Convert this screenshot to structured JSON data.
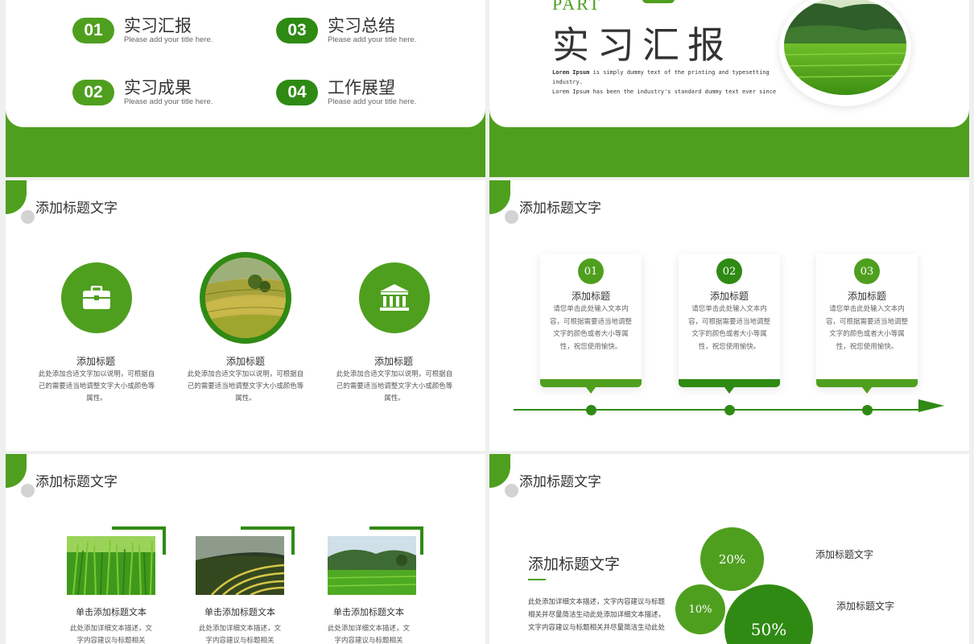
{
  "colors": {
    "primary": "#4f9f1f",
    "dark": "#2f8a14",
    "light_gray": "#d3d3d3"
  },
  "slide1": {
    "items": [
      {
        "num": "01",
        "title": "实习汇报",
        "sub": "Please add your title here."
      },
      {
        "num": "02",
        "title": "实习成果",
        "sub": "Please add your title here."
      },
      {
        "num": "03",
        "title": "实习总结",
        "sub": "Please add your title here."
      },
      {
        "num": "04",
        "title": "工作展望",
        "sub": "Please add your title here."
      }
    ]
  },
  "slide2": {
    "part": "PART",
    "title": "实习汇报",
    "lorem_bold": "Lorem Ipsum",
    "lorem_line1": " is simply dummy text of the printing and typesetting industry.",
    "lorem_line2": "Lorem Ipsum has been the industry's standard dummy text ever since"
  },
  "slide3": {
    "title": "添加标题文字",
    "columns": [
      {
        "icon": "briefcase-icon",
        "title": "添加标题",
        "text": "此处添加合适文字加以说明，可根据自己的需要适当地调整文字大小或颜色等属性。"
      },
      {
        "icon": "terraced-field-photo",
        "title": "添加标题",
        "text": "此处添加合适文字加以说明，可根据自己的需要适当地调整文字大小或颜色等属性。"
      },
      {
        "icon": "bank-icon",
        "title": "添加标题",
        "text": "此处添加合适文字加以说明，可根据自己的需要适当地调整文字大小或颜色等属性。"
      }
    ]
  },
  "slide4": {
    "title": "添加标题文字",
    "cards": [
      {
        "num": "01",
        "title": "添加标题",
        "text": "请您单击此处输入文本内容，可根据需要适当地调整文字的颜色或者大小等属性，祝您使用愉快。"
      },
      {
        "num": "02",
        "title": "添加标题",
        "text": "请您单击此处输入文本内容，可根据需要适当地调整文字的颜色或者大小等属性，祝您使用愉快。"
      },
      {
        "num": "03",
        "title": "添加标题",
        "text": "请您单击此处输入文本内容，可根据需要适当地调整文字的颜色或者大小等属性，祝您使用愉快。"
      }
    ]
  },
  "slide5": {
    "title": "添加标题文字",
    "items": [
      {
        "title": "单击添加标题文本",
        "text": "此处添加详细文本描述，文字内容建议与标题相关"
      },
      {
        "title": "单击添加标题文本",
        "text": "此处添加详细文本描述，文字内容建议与标题相关"
      },
      {
        "title": "单击添加标题文本",
        "text": "此处添加详细文本描述，文字内容建议与标题相关"
      }
    ]
  },
  "slide6": {
    "title": "添加标题文字",
    "heading": "添加标题文字",
    "body": "此处添加详细文本描述，文字内容建议与标题相关并尽量简洁生动此处添加详细文本描述，文字内容建议与标题相关并尽量简洁生动此处",
    "bubbles": [
      {
        "label": "20%",
        "value": 20
      },
      {
        "label": "10%",
        "value": 10
      },
      {
        "label": "50%",
        "value": 50
      }
    ],
    "labels": [
      "添加标题文字",
      "添加标题文字"
    ]
  }
}
